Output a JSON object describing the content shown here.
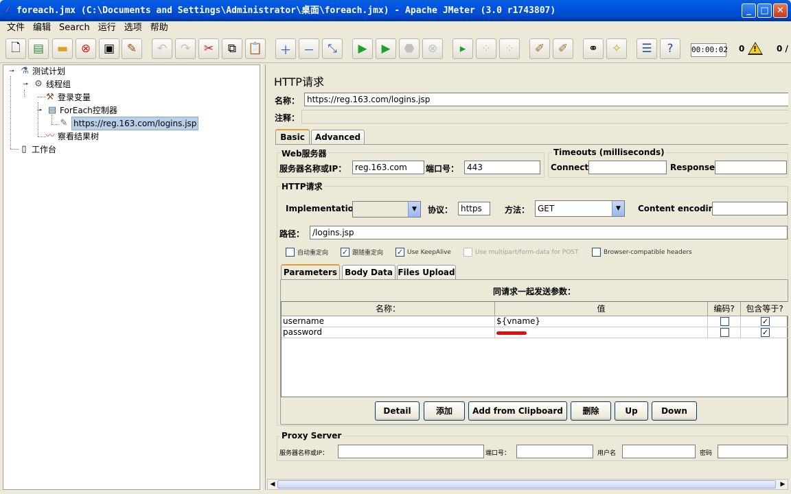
{
  "window": {
    "title": "foreach.jmx (C:\\Documents and Settings\\Administrator\\桌面\\foreach.jmx) - Apache JMeter (3.0 r1743807)",
    "min": "_",
    "max": "□",
    "close": "✕"
  },
  "menu": [
    "文件",
    "编辑",
    "Search",
    "运行",
    "选项",
    "帮助"
  ],
  "status": {
    "timer": "00:00:02",
    "warnings": "0",
    "threads": "0 /"
  },
  "tree": {
    "plan": "测试计划",
    "thread_group": "线程组",
    "login_vars": "登录变量",
    "foreach": "ForEach控制器",
    "sampler": "https://reg.163.com/logins.jsp",
    "results": "察看结果树",
    "workbench": "工作台"
  },
  "panel": {
    "title": "HTTP请求",
    "name_label": "名称：",
    "name_value": "https://reg.163.com/logins.jsp",
    "comment_label": "注释：",
    "comment_value": "",
    "tabs": [
      "Basic",
      "Advanced"
    ],
    "web_server": {
      "legend": "Web服务器",
      "server_label": "服务器名称或IP：",
      "server_value": "reg.163.com",
      "port_label": "端口号：",
      "port_value": "443"
    },
    "timeouts": {
      "legend": "Timeouts (milliseconds)",
      "connect_label": "Connect:",
      "connect_value": "",
      "response_label": "Response:",
      "response_value": ""
    },
    "http": {
      "legend": "HTTP请求",
      "impl_label": "Implementation:",
      "impl_value": "",
      "proto_label": "协议：",
      "proto_value": "https",
      "method_label": "方法：",
      "method_value": "GET",
      "enc_label": "Content encoding:",
      "enc_value": "",
      "path_label": "路径：",
      "path_value": "/logins.jsp"
    },
    "options": [
      {
        "label": "自动重定向",
        "checked": false,
        "enabled": true
      },
      {
        "label": "跟随重定向",
        "checked": true,
        "enabled": true
      },
      {
        "label": "Use KeepAlive",
        "checked": true,
        "enabled": true
      },
      {
        "label": "Use multipart/form-data for POST",
        "checked": false,
        "enabled": false
      },
      {
        "label": "Browser-compatible headers",
        "checked": false,
        "enabled": true
      }
    ],
    "subtabs": [
      "Parameters",
      "Body Data",
      "Files Upload"
    ],
    "params": {
      "caption": "同请求一起发送参数：",
      "headers": [
        "名称：",
        "值",
        "编码?",
        "包含等于?"
      ],
      "rows": [
        {
          "name": "username",
          "value": "${vname}",
          "encode": false,
          "include": true
        },
        {
          "name": "password",
          "value": "",
          "encode": false,
          "include": true
        }
      ]
    },
    "buttons": [
      "Detail",
      "添加",
      "Add from Clipboard",
      "删除",
      "Up",
      "Down"
    ],
    "proxy": {
      "legend": "Proxy Server",
      "server_label": "服务器名称或IP：",
      "port_label": "端口号：",
      "user_label": "用户名",
      "pass_label": "密码"
    }
  }
}
